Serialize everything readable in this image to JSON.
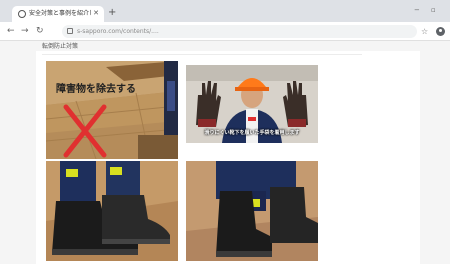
{
  "browser": {
    "tab": {
      "title": "安全対策と事例を紹介します"
    },
    "new_tab_symbol": "+",
    "address_bar": {
      "url": "s-sapporo.com/contents/...."
    },
    "window_controls": {
      "minimize": "−",
      "maximize": "▫"
    },
    "nav": {
      "back": "←",
      "forward": "→",
      "reload": "↻",
      "bookmark": "☆"
    }
  },
  "page": {
    "heading": "転倒防止対策",
    "images": [
      {
        "label": "障害物を除去する",
        "mark": "✕",
        "mark_color": "#e03030"
      },
      {
        "caption": "滑りにくい靴下を履いた手袋を着用します"
      },
      {},
      {}
    ]
  },
  "colors": {
    "mark_red": "#e03030",
    "safety_yellow": "#d8e020",
    "helmet_orange": "#ff7a1a",
    "jacket_navy": "#1e2f5c"
  }
}
